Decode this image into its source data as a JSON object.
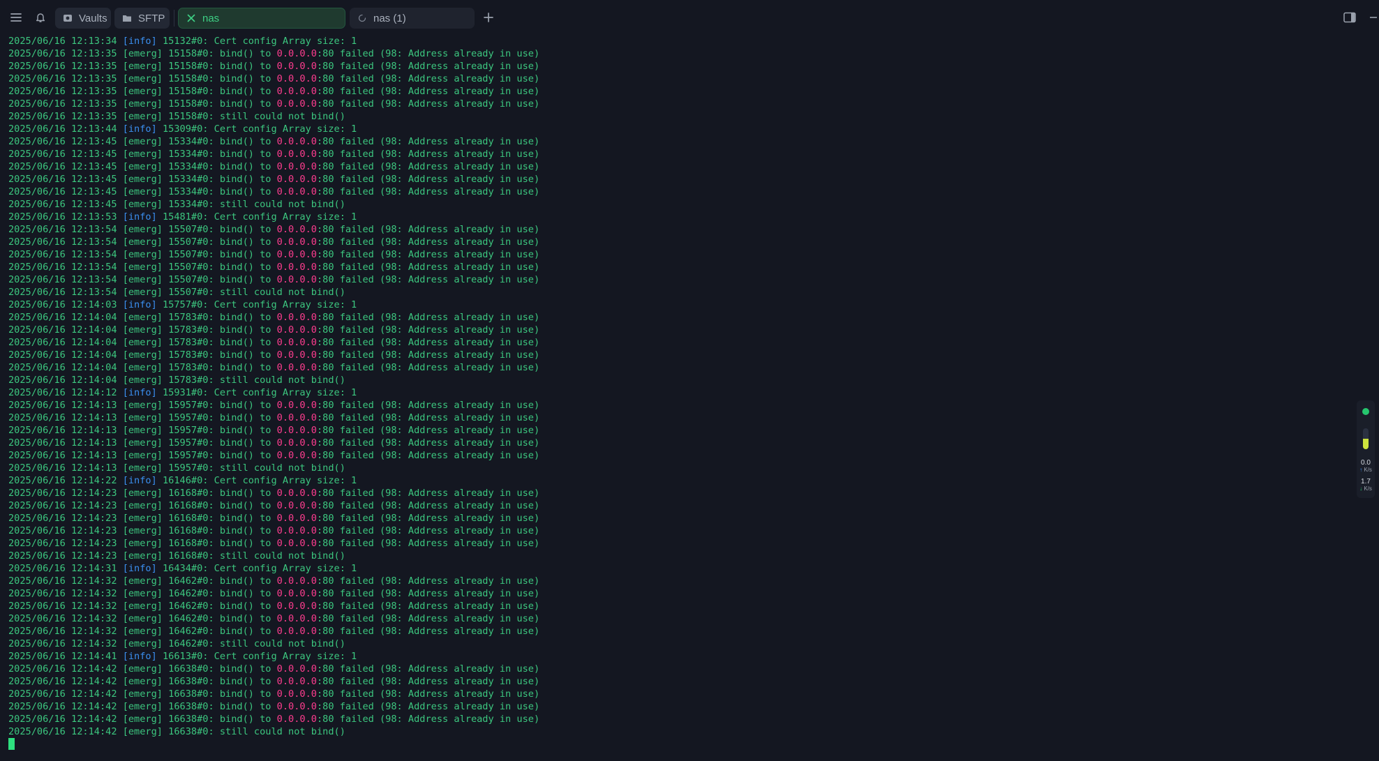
{
  "tabs": {
    "vaults": "Vaults",
    "sftp": "SFTP",
    "nas": "nas",
    "nas1": "nas (1)"
  },
  "terminal": {
    "lines": [
      {
        "ts": "2025/06/16 12:13:34",
        "lvl": "info",
        "pid": "15132",
        "kind": "cert"
      },
      {
        "ts": "2025/06/16 12:13:35",
        "lvl": "emerg",
        "pid": "15158",
        "kind": "bind"
      },
      {
        "ts": "2025/06/16 12:13:35",
        "lvl": "emerg",
        "pid": "15158",
        "kind": "bind"
      },
      {
        "ts": "2025/06/16 12:13:35",
        "lvl": "emerg",
        "pid": "15158",
        "kind": "bind"
      },
      {
        "ts": "2025/06/16 12:13:35",
        "lvl": "emerg",
        "pid": "15158",
        "kind": "bind"
      },
      {
        "ts": "2025/06/16 12:13:35",
        "lvl": "emerg",
        "pid": "15158",
        "kind": "bind"
      },
      {
        "ts": "2025/06/16 12:13:35",
        "lvl": "emerg",
        "pid": "15158",
        "kind": "still"
      },
      {
        "ts": "2025/06/16 12:13:44",
        "lvl": "info",
        "pid": "15309",
        "kind": "cert"
      },
      {
        "ts": "2025/06/16 12:13:45",
        "lvl": "emerg",
        "pid": "15334",
        "kind": "bind"
      },
      {
        "ts": "2025/06/16 12:13:45",
        "lvl": "emerg",
        "pid": "15334",
        "kind": "bind"
      },
      {
        "ts": "2025/06/16 12:13:45",
        "lvl": "emerg",
        "pid": "15334",
        "kind": "bind"
      },
      {
        "ts": "2025/06/16 12:13:45",
        "lvl": "emerg",
        "pid": "15334",
        "kind": "bind"
      },
      {
        "ts": "2025/06/16 12:13:45",
        "lvl": "emerg",
        "pid": "15334",
        "kind": "bind"
      },
      {
        "ts": "2025/06/16 12:13:45",
        "lvl": "emerg",
        "pid": "15334",
        "kind": "still"
      },
      {
        "ts": "2025/06/16 12:13:53",
        "lvl": "info",
        "pid": "15481",
        "kind": "cert"
      },
      {
        "ts": "2025/06/16 12:13:54",
        "lvl": "emerg",
        "pid": "15507",
        "kind": "bind"
      },
      {
        "ts": "2025/06/16 12:13:54",
        "lvl": "emerg",
        "pid": "15507",
        "kind": "bind"
      },
      {
        "ts": "2025/06/16 12:13:54",
        "lvl": "emerg",
        "pid": "15507",
        "kind": "bind"
      },
      {
        "ts": "2025/06/16 12:13:54",
        "lvl": "emerg",
        "pid": "15507",
        "kind": "bind"
      },
      {
        "ts": "2025/06/16 12:13:54",
        "lvl": "emerg",
        "pid": "15507",
        "kind": "bind"
      },
      {
        "ts": "2025/06/16 12:13:54",
        "lvl": "emerg",
        "pid": "15507",
        "kind": "still"
      },
      {
        "ts": "2025/06/16 12:14:03",
        "lvl": "info",
        "pid": "15757",
        "kind": "cert"
      },
      {
        "ts": "2025/06/16 12:14:04",
        "lvl": "emerg",
        "pid": "15783",
        "kind": "bind"
      },
      {
        "ts": "2025/06/16 12:14:04",
        "lvl": "emerg",
        "pid": "15783",
        "kind": "bind"
      },
      {
        "ts": "2025/06/16 12:14:04",
        "lvl": "emerg",
        "pid": "15783",
        "kind": "bind"
      },
      {
        "ts": "2025/06/16 12:14:04",
        "lvl": "emerg",
        "pid": "15783",
        "kind": "bind"
      },
      {
        "ts": "2025/06/16 12:14:04",
        "lvl": "emerg",
        "pid": "15783",
        "kind": "bind"
      },
      {
        "ts": "2025/06/16 12:14:04",
        "lvl": "emerg",
        "pid": "15783",
        "kind": "still"
      },
      {
        "ts": "2025/06/16 12:14:12",
        "lvl": "info",
        "pid": "15931",
        "kind": "cert"
      },
      {
        "ts": "2025/06/16 12:14:13",
        "lvl": "emerg",
        "pid": "15957",
        "kind": "bind"
      },
      {
        "ts": "2025/06/16 12:14:13",
        "lvl": "emerg",
        "pid": "15957",
        "kind": "bind"
      },
      {
        "ts": "2025/06/16 12:14:13",
        "lvl": "emerg",
        "pid": "15957",
        "kind": "bind"
      },
      {
        "ts": "2025/06/16 12:14:13",
        "lvl": "emerg",
        "pid": "15957",
        "kind": "bind"
      },
      {
        "ts": "2025/06/16 12:14:13",
        "lvl": "emerg",
        "pid": "15957",
        "kind": "bind"
      },
      {
        "ts": "2025/06/16 12:14:13",
        "lvl": "emerg",
        "pid": "15957",
        "kind": "still"
      },
      {
        "ts": "2025/06/16 12:14:22",
        "lvl": "info",
        "pid": "16146",
        "kind": "cert"
      },
      {
        "ts": "2025/06/16 12:14:23",
        "lvl": "emerg",
        "pid": "16168",
        "kind": "bind"
      },
      {
        "ts": "2025/06/16 12:14:23",
        "lvl": "emerg",
        "pid": "16168",
        "kind": "bind"
      },
      {
        "ts": "2025/06/16 12:14:23",
        "lvl": "emerg",
        "pid": "16168",
        "kind": "bind"
      },
      {
        "ts": "2025/06/16 12:14:23",
        "lvl": "emerg",
        "pid": "16168",
        "kind": "bind"
      },
      {
        "ts": "2025/06/16 12:14:23",
        "lvl": "emerg",
        "pid": "16168",
        "kind": "bind"
      },
      {
        "ts": "2025/06/16 12:14:23",
        "lvl": "emerg",
        "pid": "16168",
        "kind": "still"
      },
      {
        "ts": "2025/06/16 12:14:31",
        "lvl": "info",
        "pid": "16434",
        "kind": "cert"
      },
      {
        "ts": "2025/06/16 12:14:32",
        "lvl": "emerg",
        "pid": "16462",
        "kind": "bind"
      },
      {
        "ts": "2025/06/16 12:14:32",
        "lvl": "emerg",
        "pid": "16462",
        "kind": "bind"
      },
      {
        "ts": "2025/06/16 12:14:32",
        "lvl": "emerg",
        "pid": "16462",
        "kind": "bind"
      },
      {
        "ts": "2025/06/16 12:14:32",
        "lvl": "emerg",
        "pid": "16462",
        "kind": "bind"
      },
      {
        "ts": "2025/06/16 12:14:32",
        "lvl": "emerg",
        "pid": "16462",
        "kind": "bind"
      },
      {
        "ts": "2025/06/16 12:14:32",
        "lvl": "emerg",
        "pid": "16462",
        "kind": "still"
      },
      {
        "ts": "2025/06/16 12:14:41",
        "lvl": "info",
        "pid": "16613",
        "kind": "cert"
      },
      {
        "ts": "2025/06/16 12:14:42",
        "lvl": "emerg",
        "pid": "16638",
        "kind": "bind"
      },
      {
        "ts": "2025/06/16 12:14:42",
        "lvl": "emerg",
        "pid": "16638",
        "kind": "bind"
      },
      {
        "ts": "2025/06/16 12:14:42",
        "lvl": "emerg",
        "pid": "16638",
        "kind": "bind"
      },
      {
        "ts": "2025/06/16 12:14:42",
        "lvl": "emerg",
        "pid": "16638",
        "kind": "bind"
      },
      {
        "ts": "2025/06/16 12:14:42",
        "lvl": "emerg",
        "pid": "16638",
        "kind": "bind"
      },
      {
        "ts": "2025/06/16 12:14:42",
        "lvl": "emerg",
        "pid": "16638",
        "kind": "still"
      }
    ],
    "templates": {
      "cert": "#0: Cert config Array size: 1",
      "bind_pre": "#0: bind() to ",
      "bind_addr": "0.0.0.0",
      "bind_post": ":80 failed (98: Address already in use)",
      "still": "#0: still could not bind()"
    }
  },
  "side_panel": {
    "status_color": "#26c66e",
    "gauge_level": 0.5,
    "upload_value": "0.0",
    "upload_unit": "K/s",
    "download_value": "1.7",
    "download_unit": "K/s"
  },
  "colors": {
    "background": "#141721",
    "text_green": "#3cc77f",
    "info_blue": "#3a8ff0",
    "address_pink": "#ff3d8f"
  }
}
